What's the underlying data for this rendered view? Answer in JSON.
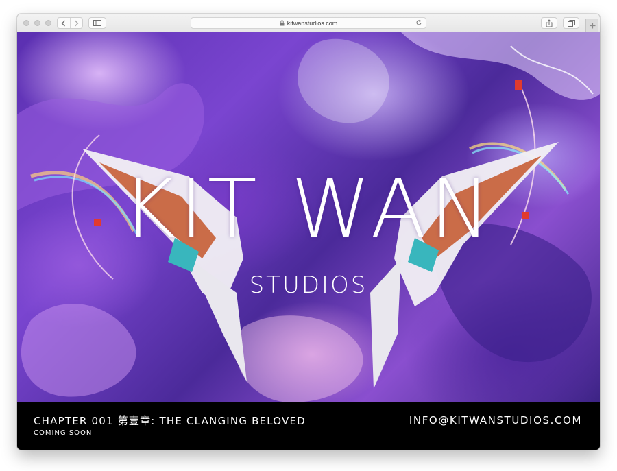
{
  "browser": {
    "address_bar": {
      "url": "kitwanstudios.com"
    },
    "icons": {
      "back": "chevron-left-icon",
      "forward": "chevron-right-icon",
      "sidebar": "sidebar-icon",
      "lock": "lock-icon",
      "reload": "reload-icon",
      "share": "share-icon",
      "tabs": "tabs-overview-icon",
      "new_tab": "plus-icon"
    }
  },
  "hero": {
    "logo_main": "KIT WAN",
    "logo_sub": "STUDIOS",
    "colors": {
      "primary": "#6a3cc4",
      "highlight": "#e8c6ff",
      "text": "#ffffff"
    }
  },
  "footer": {
    "chapter_title": "CHAPTER 001 第壹章: THE CLANGING BELOVED",
    "status": "COMING SOON",
    "email": "INFO@KITWANSTUDIOS.COM",
    "background": "#000000"
  }
}
